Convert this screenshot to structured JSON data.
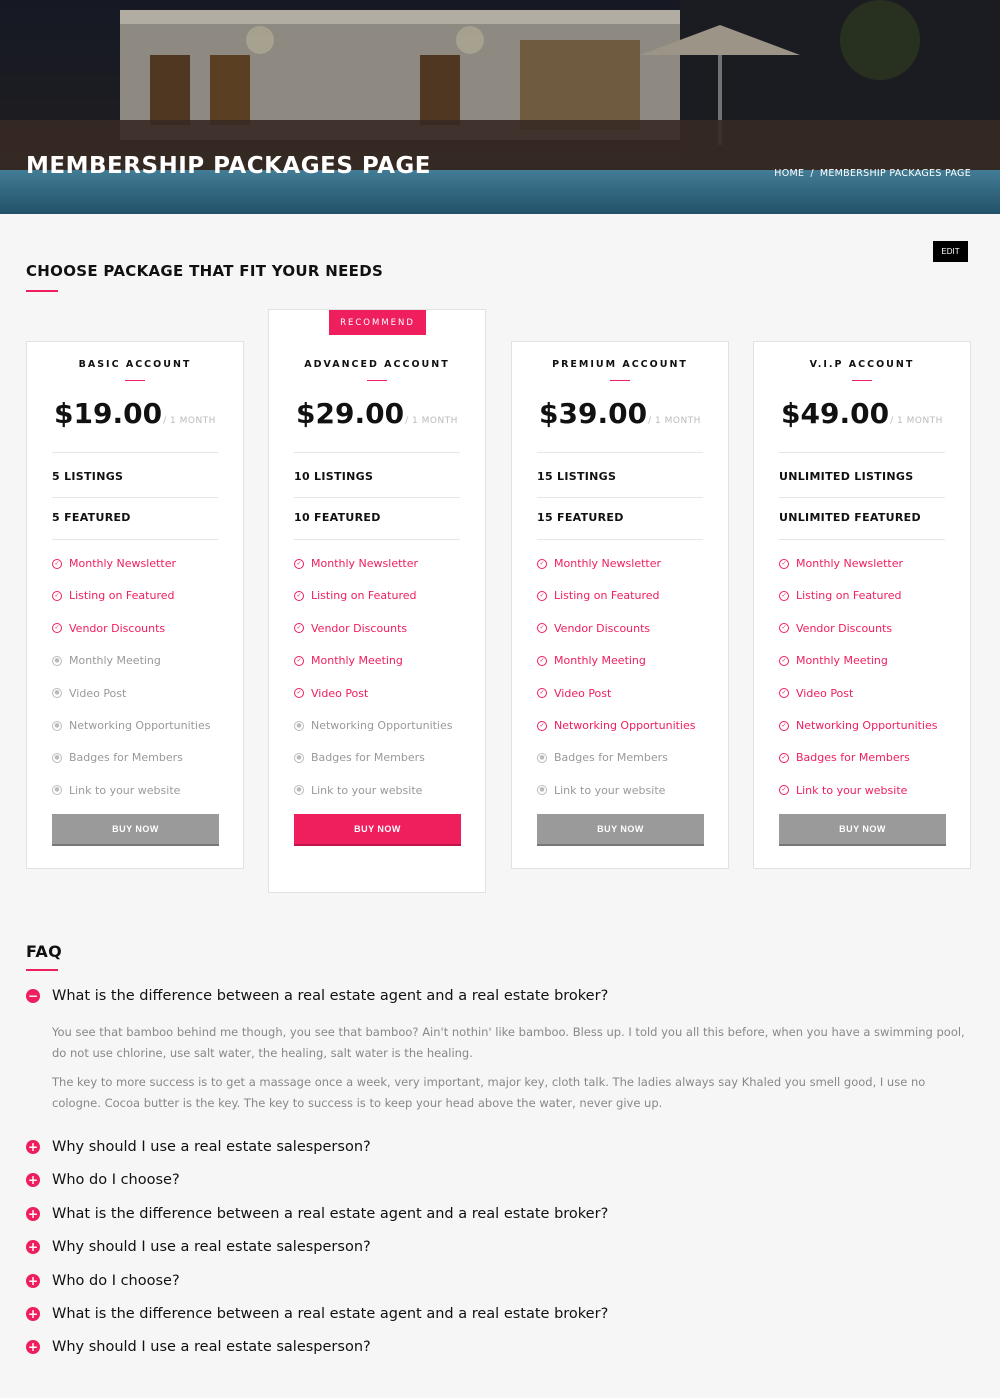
{
  "header": {
    "title": "MEMBERSHIP PACKAGES PAGE",
    "breadcrumb": {
      "home": "HOME",
      "sep": "/",
      "current": "MEMBERSHIP PACKAGES PAGE"
    }
  },
  "edit_label": "EDIT",
  "packages_section": {
    "title": "CHOOSE PACKAGE THAT FIT YOUR NEEDS"
  },
  "accent_color": "#ef1e5d",
  "packages": [
    {
      "name": "BASIC ACCOUNT",
      "price": "$19.00",
      "period": "/ 1 MONTH",
      "listings": "5 LISTINGS",
      "featured": "5 FEATURED",
      "recommended": false,
      "features": [
        {
          "label": "Monthly Newsletter",
          "included": true
        },
        {
          "label": "Listing on Featured",
          "included": true
        },
        {
          "label": "Vendor Discounts",
          "included": true
        },
        {
          "label": "Monthly Meeting",
          "included": false
        },
        {
          "label": "Video Post",
          "included": false
        },
        {
          "label": "Networking Opportunities",
          "included": false
        },
        {
          "label": "Badges for Members",
          "included": false
        },
        {
          "label": "Link to your website",
          "included": false
        }
      ],
      "button": "BUY NOW"
    },
    {
      "name": "ADVANCED ACCOUNT",
      "price": "$29.00",
      "period": "/ 1 MONTH",
      "listings": "10 LISTINGS",
      "featured": "10 FEATURED",
      "recommended": true,
      "recommend_label": "RECOMMEND",
      "features": [
        {
          "label": "Monthly Newsletter",
          "included": true
        },
        {
          "label": "Listing on Featured",
          "included": true
        },
        {
          "label": "Vendor Discounts",
          "included": true
        },
        {
          "label": "Monthly Meeting",
          "included": true
        },
        {
          "label": "Video Post",
          "included": true
        },
        {
          "label": "Networking Opportunities",
          "included": false
        },
        {
          "label": "Badges for Members",
          "included": false
        },
        {
          "label": "Link to your website",
          "included": false
        }
      ],
      "button": "BUY NOW"
    },
    {
      "name": "PREMIUM ACCOUNT",
      "price": "$39.00",
      "period": "/ 1 MONTH",
      "listings": "15 LISTINGS",
      "featured": "15 FEATURED",
      "recommended": false,
      "features": [
        {
          "label": "Monthly Newsletter",
          "included": true
        },
        {
          "label": "Listing on Featured",
          "included": true
        },
        {
          "label": "Vendor Discounts",
          "included": true
        },
        {
          "label": "Monthly Meeting",
          "included": true
        },
        {
          "label": "Video Post",
          "included": true
        },
        {
          "label": "Networking Opportunities",
          "included": true
        },
        {
          "label": "Badges for Members",
          "included": false
        },
        {
          "label": "Link to your website",
          "included": false
        }
      ],
      "button": "BUY NOW"
    },
    {
      "name": "V.I.P ACCOUNT",
      "price": "$49.00",
      "period": "/ 1 MONTH",
      "listings": "UNLIMITED LISTINGS",
      "featured": "UNLIMITED FEATURED",
      "recommended": false,
      "features": [
        {
          "label": "Monthly Newsletter",
          "included": true
        },
        {
          "label": "Listing on Featured",
          "included": true
        },
        {
          "label": "Vendor Discounts",
          "included": true
        },
        {
          "label": "Monthly Meeting",
          "included": true
        },
        {
          "label": "Video Post",
          "included": true
        },
        {
          "label": "Networking Opportunities",
          "included": true
        },
        {
          "label": "Badges for Members",
          "included": true
        },
        {
          "label": "Link to your website",
          "included": true
        }
      ],
      "button": "BUY NOW"
    }
  ],
  "faq": {
    "title": "FAQ",
    "items": [
      {
        "question": "What is the difference between a real estate agent and a real estate broker?",
        "expanded": true,
        "answer": [
          "You see that bamboo behind me though, you see that bamboo? Ain't nothin' like bamboo. Bless up. I told you all this before, when you have a swimming pool, do not use chlorine, use salt water, the healing, salt water is the healing.",
          "The key to more success is to get a massage once a week, very important, major key, cloth talk. The ladies always say Khaled you smell good, I use no cologne. Cocoa butter is the key. The key to success is to keep your head above the water, never give up."
        ]
      },
      {
        "question": "Why should I use a real estate salesperson?",
        "expanded": false
      },
      {
        "question": "Who do I choose?",
        "expanded": false
      },
      {
        "question": "What is the difference between a real estate agent and a real estate broker?",
        "expanded": false
      },
      {
        "question": "Why should I use a real estate salesperson?",
        "expanded": false
      },
      {
        "question": "Who do I choose?",
        "expanded": false
      },
      {
        "question": "What is the difference between a real estate agent and a real estate broker?",
        "expanded": false
      },
      {
        "question": "Why should I use a real estate salesperson?",
        "expanded": false
      }
    ]
  }
}
